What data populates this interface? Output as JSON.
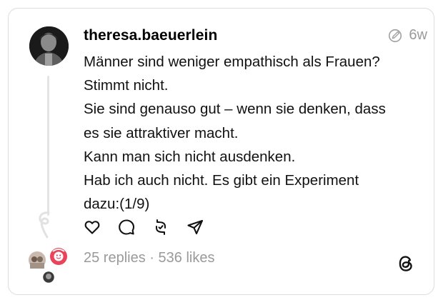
{
  "post": {
    "username": "theresa.baeuerlein",
    "age": "6w",
    "lines": [
      "Männer sind weniger empathisch als Frauen?",
      "Stimmt nicht.",
      "Sie sind genauso gut – wenn sie denken, dass",
      "es sie attraktiver macht.",
      "Kann man sich nicht ausdenken.",
      "Hab ich auch nicht. Es gibt ein Experiment",
      "dazu:(1/9)"
    ]
  },
  "stats": {
    "replies": "25 replies",
    "separator": "·",
    "likes": "536 likes"
  },
  "icons": {
    "edited": "edited-pencil-icon",
    "like": "heart-icon",
    "reply": "comment-icon",
    "repost": "repost-icon",
    "share": "share-icon",
    "brand": "threads-logo-icon"
  },
  "colors": {
    "muted": "#9a9a9a",
    "reaction_badge": "#e8455b"
  }
}
